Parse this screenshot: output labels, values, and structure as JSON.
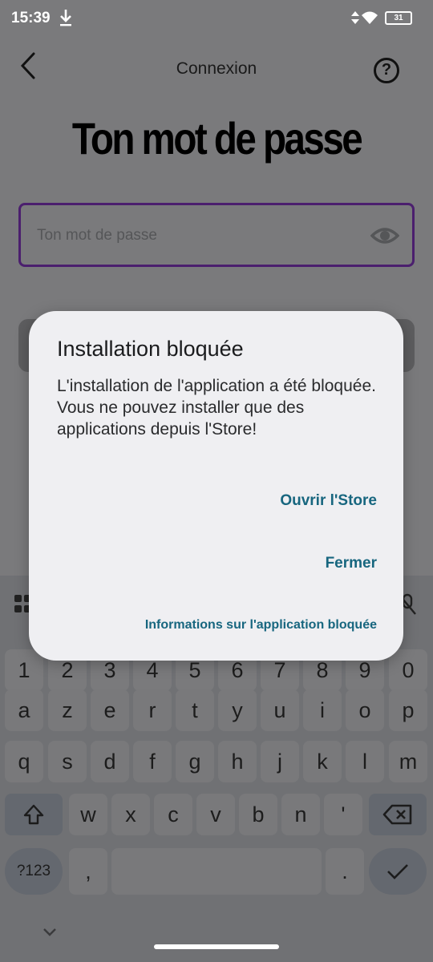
{
  "status_bar": {
    "time": "15:39",
    "battery": "31"
  },
  "header": {
    "title": "Connexion"
  },
  "page": {
    "title": "Ton mot de passe"
  },
  "password_field": {
    "placeholder": "Ton mot de passe",
    "value": ""
  },
  "dialog": {
    "title": "Installation bloquée",
    "message_line1": "L'installation de l'application a été bloquée.",
    "message_line2": "Vous ne pouvez installer que des applications depuis l'Store!",
    "open_store_label": "Ouvrir l'Store",
    "close_label": "Fermer",
    "info_label": "Informations sur l'application bloquée"
  },
  "keyboard": {
    "row_numbers": [
      "1",
      "2",
      "3",
      "4",
      "5",
      "6",
      "7",
      "8",
      "9",
      "0"
    ],
    "row1": [
      "a",
      "z",
      "e",
      "r",
      "t",
      "y",
      "u",
      "i",
      "o",
      "p"
    ],
    "row2": [
      "q",
      "s",
      "d",
      "f",
      "g",
      "h",
      "j",
      "k",
      "l",
      "m"
    ],
    "row3": [
      "w",
      "x",
      "c",
      "v",
      "b",
      "n",
      "'"
    ],
    "symbols_label": "?123",
    "comma_label": ",",
    "period_label": "."
  },
  "colors": {
    "accent": "#17667f",
    "field_border": "#4b1f6e",
    "dialog_bg": "#efeff2",
    "scrim": "#7a7a7c"
  }
}
